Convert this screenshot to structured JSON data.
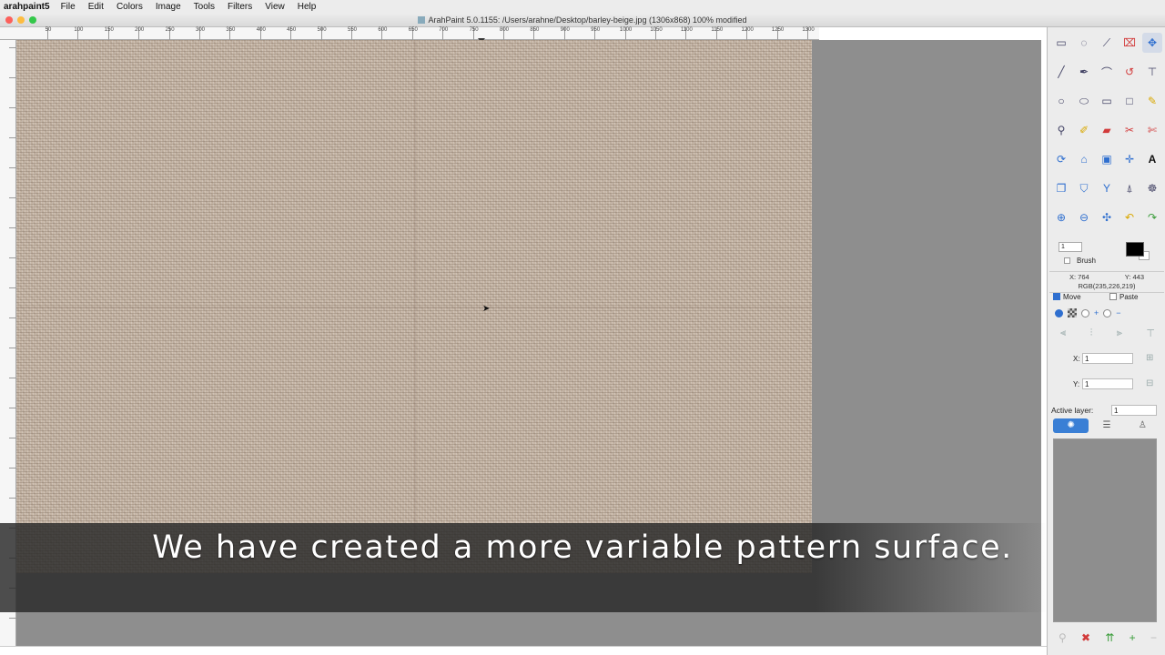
{
  "menubar": {
    "app_name": "arahpaint5",
    "items": [
      "File",
      "Edit",
      "Colors",
      "Image",
      "Tools",
      "Filters",
      "View",
      "Help"
    ]
  },
  "window": {
    "title": "ArahPaint 5.0.1155: /Users/arahne/Desktop/barley-beige.jpg (1306x868) 100% modified"
  },
  "ruler": {
    "unit": "points",
    "top_ticks": [
      "50",
      "100",
      "150",
      "200",
      "250",
      "300",
      "350",
      "400",
      "450",
      "500",
      "550",
      "600",
      "650",
      "700",
      "750",
      "800",
      "850",
      "900",
      "950",
      "1000",
      "1050",
      "1100",
      "1150",
      "1200",
      "1250",
      "1300"
    ]
  },
  "canvas": {
    "texture_name": "barley-beige",
    "texture_color": "#c6b6a6",
    "background_color": "#8e8e8e"
  },
  "subtitle": "We have created a more variable pattern surface.",
  "toolbox": {
    "tools": [
      {
        "name": "select-rect-icon",
        "glyph": "▭"
      },
      {
        "name": "lasso-icon",
        "glyph": "◌"
      },
      {
        "name": "magic-wand-icon",
        "glyph": "⟋"
      },
      {
        "name": "crop-icon",
        "glyph": "⌧"
      },
      {
        "name": "move-icon",
        "glyph": "✥"
      },
      {
        "name": "line-icon",
        "glyph": "╱"
      },
      {
        "name": "pen-icon",
        "glyph": "✒"
      },
      {
        "name": "curve-icon",
        "glyph": "⌒"
      },
      {
        "name": "bezier-icon",
        "glyph": "↺"
      },
      {
        "name": "path-icon",
        "glyph": "⊤"
      },
      {
        "name": "circle-icon",
        "glyph": "○"
      },
      {
        "name": "ellipse-icon",
        "glyph": "⬭"
      },
      {
        "name": "rectangle-icon",
        "glyph": "▭"
      },
      {
        "name": "square-icon",
        "glyph": "□"
      },
      {
        "name": "pencil-icon",
        "glyph": "✎"
      },
      {
        "name": "eyedropper-icon",
        "glyph": "⚲"
      },
      {
        "name": "brush-icon",
        "glyph": "✐"
      },
      {
        "name": "eraser-icon",
        "glyph": "▰"
      },
      {
        "name": "scissors-icon",
        "glyph": "✂"
      },
      {
        "name": "cut-icon",
        "glyph": "✄"
      },
      {
        "name": "rotate-icon",
        "glyph": "⟳"
      },
      {
        "name": "stamp-icon",
        "glyph": "⌂"
      },
      {
        "name": "picture-icon",
        "glyph": "▣"
      },
      {
        "name": "transform-icon",
        "glyph": "✛"
      },
      {
        "name": "text-icon",
        "glyph": "A"
      },
      {
        "name": "copy-icon",
        "glyph": "❐"
      },
      {
        "name": "bucket-icon",
        "glyph": "⛉"
      },
      {
        "name": "filter-icon",
        "glyph": "Y"
      },
      {
        "name": "clone-icon",
        "glyph": "⍋"
      },
      {
        "name": "smudge-icon",
        "glyph": "☸"
      },
      {
        "name": "zoom-in-icon",
        "glyph": "⊕"
      },
      {
        "name": "zoom-out-icon",
        "glyph": "⊖"
      },
      {
        "name": "fit-icon",
        "glyph": "✣"
      },
      {
        "name": "undo-icon",
        "glyph": "↶"
      },
      {
        "name": "redo-icon",
        "glyph": "↷"
      }
    ]
  },
  "brush": {
    "size": "1",
    "label": "Brush",
    "fg_color": "#000000",
    "bg_color": "#ffffff"
  },
  "pixel_info": {
    "x": "X: 764",
    "y": "Y: 443",
    "rgb": "RGB(235,226,219)"
  },
  "options": {
    "move_label": "Move",
    "paste_label": "Paste"
  },
  "position": {
    "x_label": "X:",
    "x_value": "1",
    "y_label": "Y:",
    "y_value": "1"
  },
  "layers": {
    "active_label": "Active layer:",
    "active_value": "1"
  }
}
